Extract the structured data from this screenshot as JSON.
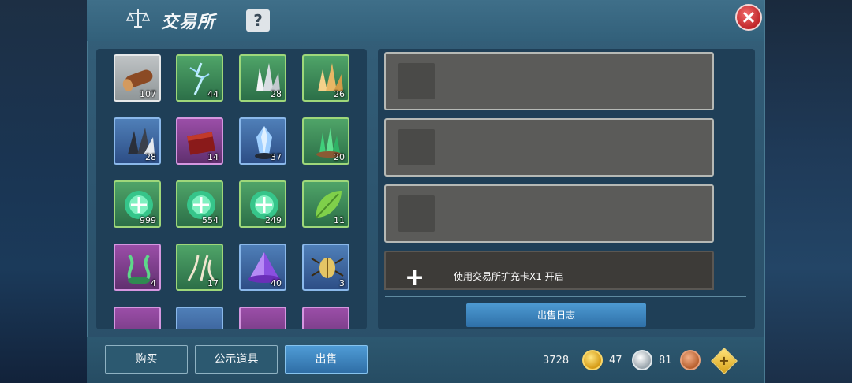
{
  "window": {
    "title": "交易所",
    "help_label": "?"
  },
  "inventory": {
    "items": [
      {
        "name": "wood-log-icon",
        "count": "107",
        "quality": "white"
      },
      {
        "name": "lightning-branch-icon",
        "count": "44",
        "quality": "green"
      },
      {
        "name": "white-crystal-icon",
        "count": "28",
        "quality": "green"
      },
      {
        "name": "gold-crystal-icon",
        "count": "26",
        "quality": "green"
      },
      {
        "name": "dark-crystal-icon",
        "count": "28",
        "quality": "blue"
      },
      {
        "name": "red-chest-icon",
        "count": "14",
        "quality": "purple"
      },
      {
        "name": "blue-crystal-icon",
        "count": "37",
        "quality": "blue"
      },
      {
        "name": "green-crystal-icon",
        "count": "20",
        "quality": "green"
      },
      {
        "name": "green-orb-icon",
        "count": "999",
        "quality": "green"
      },
      {
        "name": "green-orb-icon",
        "count": "554",
        "quality": "green"
      },
      {
        "name": "green-orb-icon",
        "count": "249",
        "quality": "green"
      },
      {
        "name": "leaf-icon",
        "count": "11",
        "quality": "green"
      },
      {
        "name": "green-vine-icon",
        "count": "4",
        "quality": "purple"
      },
      {
        "name": "bone-claw-icon",
        "count": "17",
        "quality": "green"
      },
      {
        "name": "purple-pyramid-icon",
        "count": "40",
        "quality": "blue"
      },
      {
        "name": "golden-beetle-icon",
        "count": "3",
        "quality": "blue"
      }
    ]
  },
  "sell": {
    "slots": [
      {
        "empty": true
      },
      {
        "empty": true
      },
      {
        "empty": true
      }
    ],
    "locked_slot_text": "使用交易所扩充卡X1 开启",
    "log_button": "出售日志"
  },
  "tabs": {
    "buy": "购买",
    "public_items": "公示道具",
    "sell": "出售"
  },
  "currency": {
    "gold": "3728",
    "silver": "47",
    "copper": "81"
  },
  "colors": {
    "accent_blue": "#4f9cd6",
    "panel_dark": "#1f3f57",
    "close_red": "#c0262a"
  }
}
